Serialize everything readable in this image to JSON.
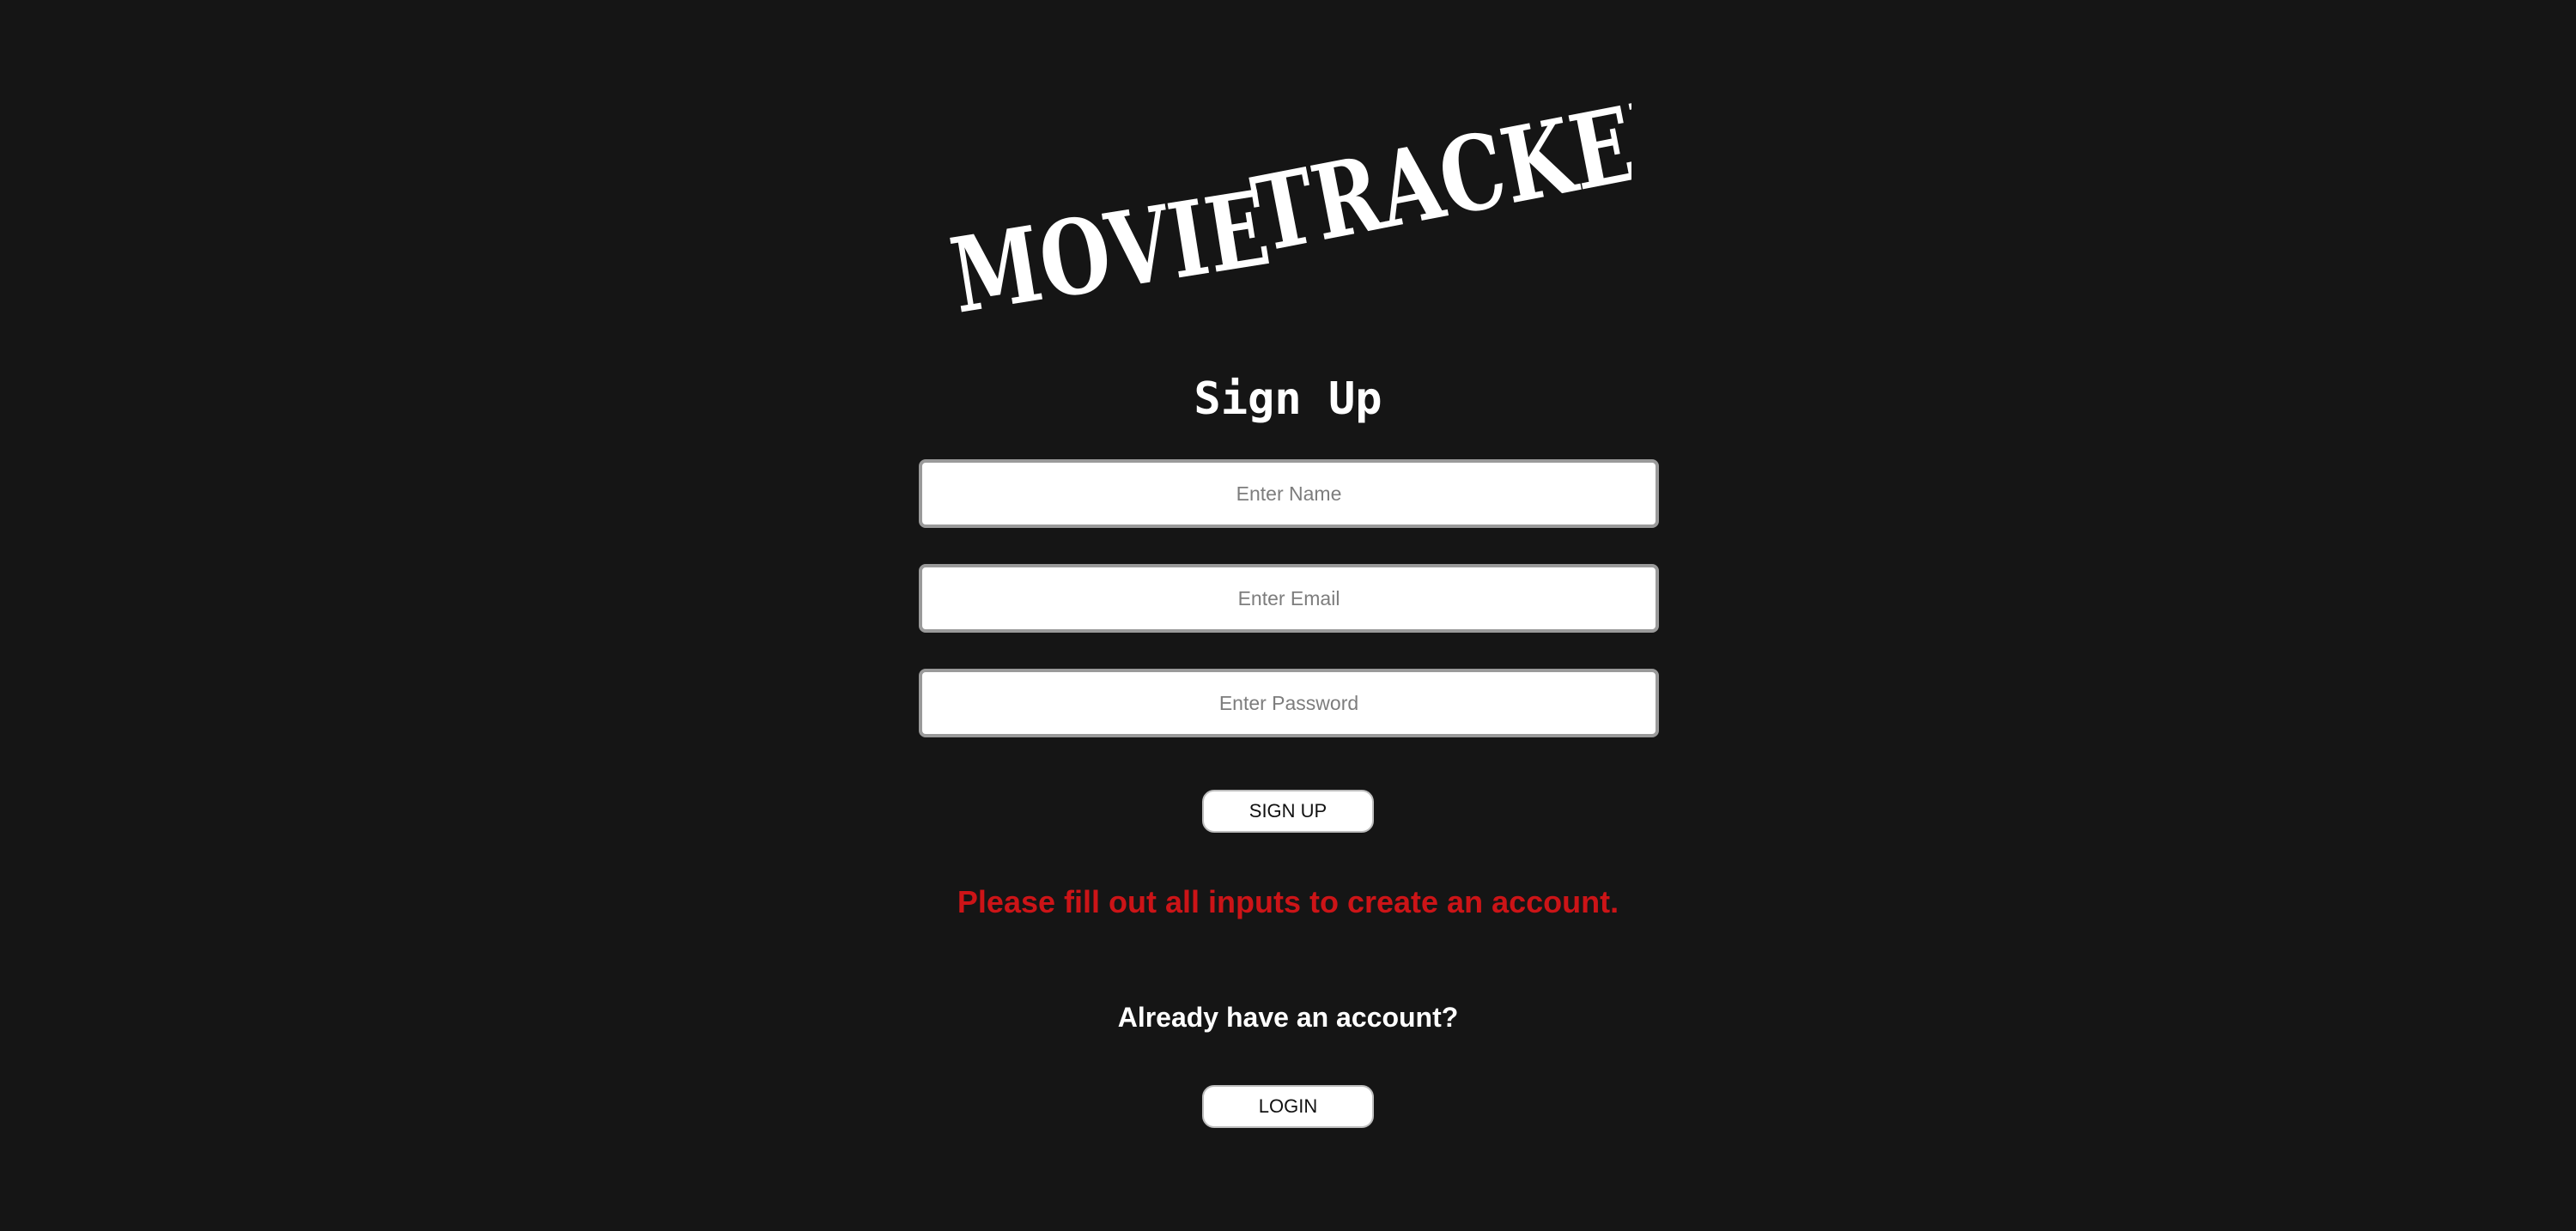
{
  "logo": {
    "word1": "MOVIE",
    "word2": "TRACKER"
  },
  "form": {
    "title": "Sign Up",
    "name_placeholder": "Enter Name",
    "email_placeholder": "Enter Email",
    "password_placeholder": "Enter Password",
    "name_value": "",
    "email_value": "",
    "password_value": "",
    "signup_label": "SIGN UP",
    "error_message": "Please fill out all inputs to create an account."
  },
  "login": {
    "prompt": "Already have an account?",
    "button_label": "LOGIN"
  },
  "colors": {
    "background": "#151515",
    "error": "#cc1417",
    "text": "#ffffff"
  }
}
